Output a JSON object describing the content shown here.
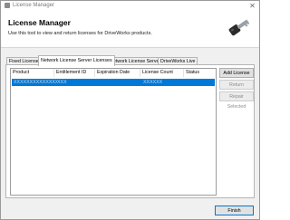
{
  "window": {
    "title": "License Manager",
    "close_glyph": "✕"
  },
  "header": {
    "title": "License Manager",
    "description": "Use this tool to view and return licenses for DriveWorks products."
  },
  "tabs": [
    {
      "label": "Fixed Licenses",
      "active": false
    },
    {
      "label": "Network License Server Licenses",
      "active": true
    },
    {
      "label": "Network License Server",
      "active": false
    },
    {
      "label": "DriveWorks Live",
      "active": false
    }
  ],
  "table": {
    "columns": [
      "Product",
      "Entitlement ID",
      "Expiration Date",
      "License Count",
      "Status"
    ],
    "rows": [
      {
        "product": "XXXXXXXXXXXXXXXXXXX",
        "entitlement_id": "XXX",
        "expiration_date": "",
        "license_count": "XXXXXX",
        "status": "",
        "selected": true
      }
    ]
  },
  "buttons": {
    "add": "Add License",
    "return": "Return Selected",
    "repair": "Repair Selected",
    "finish": "Finish"
  },
  "colors": {
    "selection": "#0078d7",
    "accent_key": "#1f6fb5"
  },
  "icons": {
    "app": "license-manager-app-icon",
    "header": "key-icon"
  }
}
